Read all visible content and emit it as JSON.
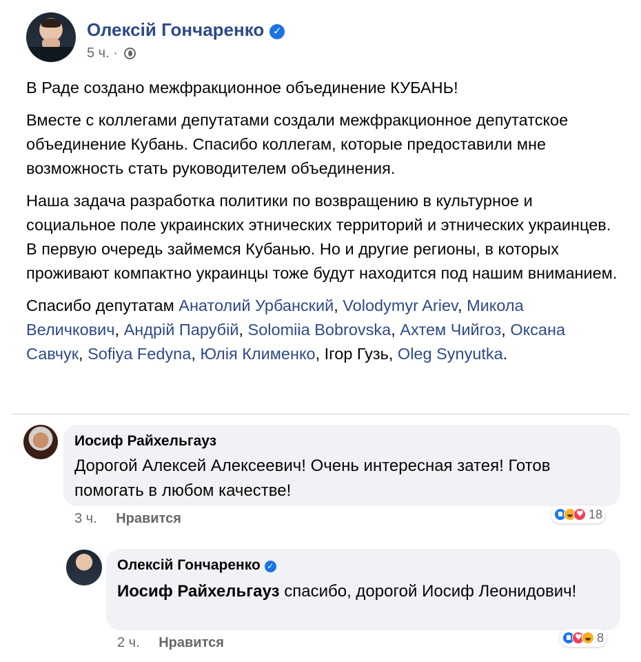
{
  "post": {
    "author": "Олексій Гончаренко",
    "time": "5 ч.",
    "separator": "·",
    "paragraphs": [
      "В Раде создано межфракционное объединение КУБАНЬ!",
      "Вместе с коллегами депутатами создали межфракционное депутатское объединение Кубань. Спасибо коллегам, которые предоставили мне возможность стать руководителем объединения.",
      "Наша задача разработка политики по возвращению в культурное и социальное поле украинских этнических территорий и этнических украинцев. В первую очередь займемся Кубанью. Но и другие регионы, в которых проживают компактно украинцы тоже будут находится под нашим вниманием."
    ],
    "thanks_prefix": "Спасибо депутатам ",
    "mentions": [
      "Анатолий Урбанский",
      "Volodymyr Ariev",
      "Микола Величкович",
      "Андрій Парубій",
      "Solomiia Bobrovska",
      "Ахтем Чийгоз",
      "Оксана Савчук",
      "Sofiya Fedyna",
      "Юлія Клименко"
    ],
    "plain_name": "Ігор Гузь",
    "last_mention": "Oleg Synyutka",
    "comma": ", ",
    "period": "."
  },
  "comments": [
    {
      "author": "Иосиф Райхельгауз",
      "text": "Дорогой Алексей Алексеевич! Очень интересная затея! Готов помогать в любом качестве!",
      "time": "3 ч.",
      "like_label": "Нравится",
      "reaction_count": "18",
      "reactions": [
        "like-icon",
        "haha-icon",
        "love-icon"
      ]
    },
    {
      "author": "Олексій Гончаренко",
      "tag": "Иосиф Райхельгауз",
      "text": " спасибо, дорогой Иосиф Леонидович!",
      "time": "2 ч.",
      "like_label": "Нравится",
      "reaction_count": "8",
      "reactions": [
        "like-icon",
        "love-icon",
        "haha-icon"
      ]
    }
  ],
  "colors": {
    "link": "#2d4a87",
    "verified": "#1b74e4",
    "bubble": "#f0f2f5",
    "meta": "#65676b"
  }
}
